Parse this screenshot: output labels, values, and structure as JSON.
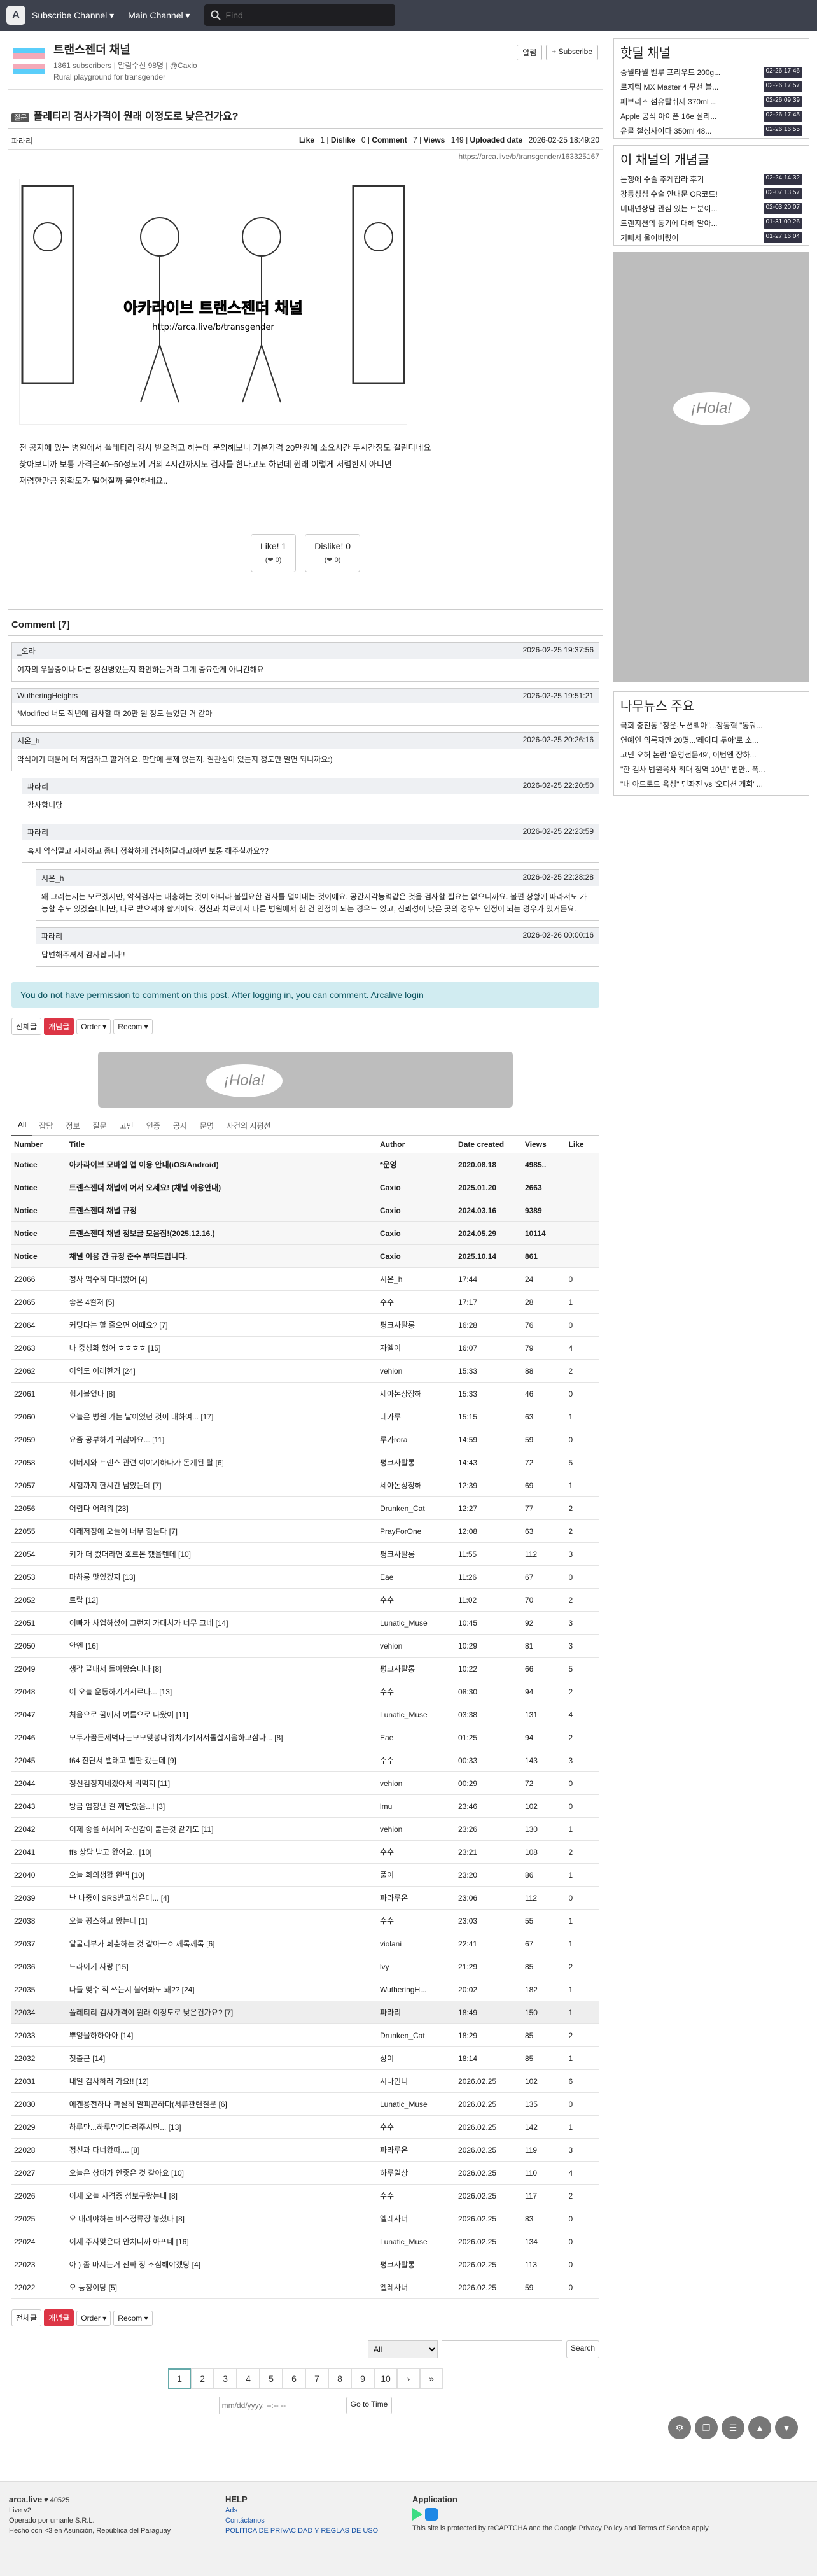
{
  "nav": {
    "subscribe_label": "Subscribe Channel ▾",
    "main_label": "Main Channel ▾",
    "search_placeholder": "Find"
  },
  "channel": {
    "title": "트랜스젠더 채널",
    "subscribers": "1861 subscribers | 알림수신 98명 | @Caxio",
    "description": "Rural playground for transgender",
    "notify_label": "알림",
    "subscribe_label": "+ Subscribe"
  },
  "post": {
    "badge": "질문",
    "title": "폴레티리 검사가격이 원래 이정도로 낮은건가요?",
    "author": "파라리",
    "like_label": "Like",
    "like": "1",
    "dislike_label": "Dislike",
    "dislike": "0",
    "comment_label": "Comment",
    "comment": "7",
    "views_label": "Views",
    "views": "149",
    "uploaded_label": "Uploaded date",
    "uploaded": "2026-02-25 18:49:20",
    "url": "https://arca.live/b/transgender/163325167",
    "watermark": "아카라이브 트랜스젠더 채널",
    "watermark_url": "http://arca.live/b/transgender",
    "body": [
      "전 공지에 있는 병원에서 폴레티리 검사 받으려고 하는데 문의해보니 기본가격 20만원에 소요시간 두시간정도 걸린다네요",
      "찾아보니까 보통 가격은40~50정도에 거의 4시간까지도 검사를 한다고도 하던데 원래 이렇게 저렴한지 아니면",
      "저렴한만큼 정확도가 떨어질까 불안하네요.."
    ],
    "like_btn": "Like! 1",
    "like_sub": "(❤ 0)",
    "dislike_btn": "Dislike! 0",
    "dislike_sub": "(❤ 0)"
  },
  "comments_title": "Comment [7]",
  "comments": [
    {
      "author": "_오라",
      "time": "2026-02-25 19:37:56",
      "text": "여자의 우울증이나 다른 정신병있는지 확인하는거라 그게 중요한게 아니긴해요"
    },
    {
      "author": "WutheringHeights",
      "time": "2026-02-25 19:51:21",
      "text": "*Modified 너도 작년에 검사할 때 20만 원 정도 들었던 거 같아"
    },
    {
      "author": "시온_h",
      "time": "2026-02-25 20:26:16",
      "text": "약식이기 때문에 더 저렴하고 할거에요. 판단에 문제 없는지, 질관성이 있는지 정도만 알면 되니까요:)"
    },
    {
      "author": "파라리",
      "time": "2026-02-25 22:20:50",
      "text": "감사합니당"
    },
    {
      "author": "파라리",
      "time": "2026-02-25 22:23:59",
      "text": "혹시 약식말고 자세하고 좀더 정확하게 검사해달라고하면 보통 해주실까요??"
    },
    {
      "author": "시온_h",
      "time": "2026-02-25 22:28:28",
      "text": "왜 그러는지는 모르겠지만, 약식검사는 대충하는 것이 아니라 불필요한 검사를 덜어내는 것이에요. 공간지각능력같은 것을 검사할 필요는 없으니까요. 불편 상황에 따라서도 가능할 수도 있겠습니다만, 따로 받으셔야 할거에요. 정신과 치료에서 다른 병원에서 한 건 인정이 되는 경우도 있고, 신뢰성이 낮은 곳의 경우도 인정이 되는 경우가 있거든요."
    },
    {
      "author": "파라리",
      "time": "2026-02-26 00:00:16",
      "text": "답변해주셔서 감사합니다!!"
    }
  ],
  "noperm": "You do not have permission to comment on this post. After logging in, you can comment.",
  "login_link": "Arcalive login",
  "filter": {
    "all": "전체글",
    "best": "개념글",
    "order": "Order ▾",
    "recom": "Recom ▾"
  },
  "ad_text": "¡Hola!",
  "tabs": [
    "All",
    "잡담",
    "정보",
    "질문",
    "고민",
    "인증",
    "공지",
    "문명",
    "사건의 지평선"
  ],
  "table_headers": [
    "Number",
    "Title",
    "Author",
    "Date created",
    "Views",
    "Like"
  ],
  "notices": [
    {
      "num": "Notice",
      "title": "아카라이브 모바일 앱 이용 안내(iOS/Android)",
      "author": "*운영",
      "date": "2020.08.18",
      "views": "4985..",
      "like": ""
    },
    {
      "num": "Notice",
      "title": "트랜스젠더 채널에 어서 오세요! (채널 이용안내)",
      "author": "Caxio",
      "date": "2025.01.20",
      "views": "2663",
      "like": ""
    },
    {
      "num": "Notice",
      "title": "트랜스젠더 채널 규정",
      "author": "Caxio",
      "date": "2024.03.16",
      "views": "9389",
      "like": ""
    },
    {
      "num": "Notice",
      "title": "트랜스젠더 채널 정보글 모음집!(2025.12.16.)",
      "author": "Caxio",
      "date": "2024.05.29",
      "views": "10114",
      "like": ""
    },
    {
      "num": "Notice",
      "title": "채널 이용 간 규정 준수 부탁드립니다.",
      "author": "Caxio",
      "date": "2025.10.14",
      "views": "861",
      "like": ""
    }
  ],
  "rows": [
    [
      "22066",
      "정사 먹수히 다녀왔어 [4]",
      "시온_h",
      "17:44",
      "24",
      "0"
    ],
    [
      "22065",
      "좋은 4컬저 [5]",
      "수수",
      "17:17",
      "28",
      "1"
    ],
    [
      "22064",
      "커밍다는 할 줄으면 어때요? [7]",
      "평크사탈롱",
      "16:28",
      "76",
      "0"
    ],
    [
      "22063",
      "나 중성화 했어 ㅎㅎㅎㅎ [15]",
      "자엘이",
      "16:07",
      "79",
      "4"
    ],
    [
      "22062",
      "어익도 어레한거 [24]",
      "vehion",
      "15:33",
      "88",
      "2"
    ],
    [
      "22061",
      "힘기볼었다 [8]",
      "세아논상장해",
      "15:33",
      "46",
      "0"
    ],
    [
      "22060",
      "오늘은 병원 가는 날이었던 것이 대하여... [17]",
      "데카루",
      "15:15",
      "63",
      "1"
    ],
    [
      "22059",
      "요즘 공부하기 귀찮아요... [11]",
      "루카rora",
      "14:59",
      "59",
      "0"
    ],
    [
      "22058",
      "이버지와 트랜스 관련 이야기하다가 돈계된 탈 [6]",
      "평크사탈롱",
      "14:43",
      "72",
      "5"
    ],
    [
      "22057",
      "시험까지 한시간 남았는데 [7]",
      "세아논상장해",
      "12:39",
      "69",
      "1"
    ],
    [
      "22056",
      "어렵다 어려워 [23]",
      "Drunken_Cat",
      "12:27",
      "77",
      "2"
    ],
    [
      "22055",
      "이래저정에 오늘이 너무 힘들다 [7]",
      "PrayForOne",
      "12:08",
      "63",
      "2"
    ],
    [
      "22054",
      "키가 더 컸더라면 호르몬 했을텐데 [10]",
      "평크사탈롱",
      "11:55",
      "112",
      "3"
    ],
    [
      "22053",
      "마하룡 맛있겠지 [13]",
      "Eae",
      "11:26",
      "67",
      "0"
    ],
    [
      "22052",
      "트랍 [12]",
      "수수",
      "11:02",
      "70",
      "2"
    ],
    [
      "22051",
      "이빠가 사업하셨어 그런지 가대치가 너무 크네 [14]",
      "Lunatic_Muse",
      "10:45",
      "92",
      "3"
    ],
    [
      "22050",
      "안엔 [16]",
      "vehion",
      "10:29",
      "81",
      "3"
    ],
    [
      "22049",
      "생각 끝내서 돌아왔습니다 [8]",
      "평크사탈롱",
      "10:22",
      "66",
      "5"
    ],
    [
      "22048",
      "어 오늘 운동하기거시르다... [13]",
      "수수",
      "08:30",
      "94",
      "2"
    ],
    [
      "22047",
      "처음으로 꿈에서 여름으로 나왔어 [11]",
      "Lunatic_Muse",
      "03:38",
      "131",
      "4"
    ],
    [
      "22046",
      "모두가꿈든세벽나는모모맞봉나위치기켜져서롤살지음하고삼다... [8]",
      "Eae",
      "01:25",
      "94",
      "2"
    ],
    [
      "22045",
      "f64 전단서 밸래고 벨판 갔는데 [9]",
      "수수",
      "00:33",
      "143",
      "3"
    ],
    [
      "22044",
      "정신검정지네겠아서 뭐먹지 [11]",
      "vehion",
      "00:29",
      "72",
      "0"
    ],
    [
      "22043",
      "방금 엄청난 걸 깨달았음...! [3]",
      "lmu",
      "23:46",
      "102",
      "0"
    ],
    [
      "22042",
      "이제 송을 해체에 자신감이 붙는것 같기도 [11]",
      "vehion",
      "23:26",
      "130",
      "1"
    ],
    [
      "22041",
      "ffs 상담 받고 왔어요.. [10]",
      "수수",
      "23:21",
      "108",
      "2"
    ],
    [
      "22040",
      "오늘 회의생활 완벽 [10]",
      "풀이",
      "23:20",
      "86",
      "1"
    ],
    [
      "22039",
      "난 나중에 SRS받고싶은데... [4]",
      "파라루온",
      "23:06",
      "112",
      "0"
    ],
    [
      "22038",
      "오늘 평스하고 왔는데 [1]",
      "수수",
      "23:03",
      "55",
      "1"
    ],
    [
      "22037",
      "알굴리부가 회춘하는 것 같아ㅡㅇ 께록께록 [6]",
      "violani",
      "22:41",
      "67",
      "1"
    ],
    [
      "22036",
      "드라이기 사랑 [15]",
      "lvy",
      "21:29",
      "85",
      "2"
    ],
    [
      "22035",
      "다들 몇수 적 쓰는지 불어봐도 돼?? [24]",
      "WutheringH...",
      "20:02",
      "182",
      "1"
    ],
    [
      "22034",
      "폴레티리 검사가격이 원래 이정도로 낮은건가요? [7]",
      "파라리",
      "18:49",
      "150",
      "1"
    ],
    [
      "22033",
      "뿌엉올하하아아 [14]",
      "Drunken_Cat",
      "18:29",
      "85",
      "2"
    ],
    [
      "22032",
      "첫출근 [14]",
      "상이",
      "18:14",
      "85",
      "1"
    ],
    [
      "22031",
      "내일 검사하러 가요!! [12]",
      "시나인니",
      "2026.02.25",
      "102",
      "6"
    ],
    [
      "22030",
      "에겐용전하나 확실히 알피곤하다(서류관련질문 [6]",
      "Lunatic_Muse",
      "2026.02.25",
      "135",
      "0"
    ],
    [
      "22029",
      "하루만...하루만기다려주시면... [13]",
      "수수",
      "2026.02.25",
      "142",
      "1"
    ],
    [
      "22028",
      "정신과 다녀왔따.... [8]",
      "파라루온",
      "2026.02.25",
      "119",
      "3"
    ],
    [
      "22027",
      "오늘은 상태가 안좋은 것 같아요 [10]",
      "하루일상",
      "2026.02.25",
      "110",
      "4"
    ],
    [
      "22026",
      "이제 오늘 자격증 셤보구왔는데 [8]",
      "수수",
      "2026.02.25",
      "117",
      "2"
    ],
    [
      "22025",
      "오 내려야하는 버스정류장 놓쳤다 [8]",
      "엘레사너",
      "2026.02.25",
      "83",
      "0"
    ],
    [
      "22024",
      "이제 주사맞은때 안치니까 아프네 [16]",
      "Lunatic_Muse",
      "2026.02.25",
      "134",
      "0"
    ],
    [
      "22023",
      "아 ) 좀 마시는거 진짜 정 조심해야겠당 [4]",
      "평크사탈롱",
      "2026.02.25",
      "113",
      "0"
    ],
    [
      "22022",
      "오 능정이당 [5]",
      "엘레사너",
      "2026.02.25",
      "59",
      "0"
    ]
  ],
  "search": {
    "select": "All",
    "button": "Search"
  },
  "pages": [
    "1",
    "2",
    "3",
    "4",
    "5",
    "6",
    "7",
    "8",
    "9",
    "10",
    "›",
    "»"
  ],
  "date_placeholder": "mm/dd/yyyy, --:-- --",
  "goto_time": "Go to Time",
  "footer": {
    "brand": "arca.live",
    "count": "♥ 40525",
    "version": "Live v2",
    "operator": "Operado por umanle S.R.L.",
    "made": "Hecho con <3 en Asunción, República del Paraguay",
    "help": "HELP",
    "ads": "Ads",
    "contact": "Contáctanos",
    "policy": "POLITICA DE PRIVACIDAD Y REGLAS DE USO",
    "app": "Application",
    "recaptcha": "This site is protected by reCAPTCHA and the Google Privacy Policy and Terms of Service apply."
  },
  "side": {
    "hot_title": "핫딜 채널",
    "hot": [
      [
        "송월타월 벨루 프리우드 200g...",
        "02-26 17:46"
      ],
      [
        "로지텍 MX Master 4 무선 블...",
        "02-26 17:57"
      ],
      [
        "페브리즈 섬유탈취제 370ml ...",
        "02-26 09:39"
      ],
      [
        "Apple 공식 아이폰 16e 실리...",
        "02-26 17:45"
      ],
      [
        "유클 철성사이다 350ml 48...",
        "02-26 16:55"
      ]
    ],
    "best_title": "이 채널의 개념글",
    "best": [
      [
        "논쟁에 수술 추게잡라 후기",
        "02-24 14:32"
      ],
      [
        "강동성심 수술 안내문 OR코드!",
        "02-07 13:57"
      ],
      [
        "비대면상담 관심 있는 트분이...",
        "02-03 20:07"
      ],
      [
        "트랜지션의 동기에 대해 알아...",
        "01-31 00:26"
      ],
      [
        "기뻐서 울어버렸어",
        "01-27 16:04"
      ]
    ],
    "ad_text": "¡Hola!",
    "news_title": "나무뉴스 주요",
    "news": [
      "국회 충진동 \"청운·노션백아\"...장동혁 \"동쿼...",
      "연예인 의록자만 20명...'레이디 두아'로 소...",
      "고민 오허 논란 '운영전문49', 이번엔 장하...",
      "\"한 검사 법원육사 최대 징역 10년\" 법안.. 폭...",
      "\"내 아드로드 육성\" 민좌진 vs '오디션 개회' ..."
    ]
  }
}
